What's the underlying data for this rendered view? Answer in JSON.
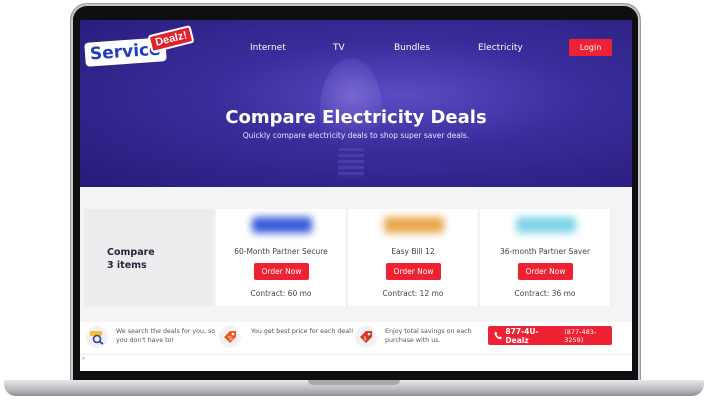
{
  "brand": {
    "logo_word": "Service",
    "logo_tag": "Dealz!"
  },
  "nav": {
    "items": [
      "Internet",
      "TV",
      "Bundles",
      "Electricity"
    ],
    "login_label": "Login"
  },
  "hero": {
    "title": "Compare Electricity Deals",
    "subtitle": "Quickly compare electricity deals to shop super saver deals."
  },
  "compare": {
    "label_line1": "Compare",
    "label_line2": "3 items",
    "plans": [
      {
        "name": "60-Month Partner Secure",
        "button": "Order Now",
        "contract": "Contract: 60 mo",
        "logo_color": "#3a5bd9"
      },
      {
        "name": "Easy Bill 12",
        "button": "Order Now",
        "contract": "Contract: 12 mo",
        "logo_color": "#e8a64a"
      },
      {
        "name": "36-month Partner Saver",
        "button": "Order Now",
        "contract": "Contract: 36 mo",
        "logo_color": "#7fd3e8"
      }
    ]
  },
  "features": [
    {
      "icon": "magnifier-deals-icon",
      "text": "We search the deals for you, so you don't have to!"
    },
    {
      "icon": "price-tag-icon",
      "text": "You get best price for each deal!"
    },
    {
      "icon": "savings-tag-icon",
      "text": "Enjoy total savings on each purchase with us."
    }
  ],
  "phone": {
    "icon": "phone-icon",
    "name": "877-4U-Dealz",
    "number": "(877-483-3259)"
  },
  "colors": {
    "accent_red": "#ef2233",
    "hero_purple": "#3a2d9c"
  }
}
